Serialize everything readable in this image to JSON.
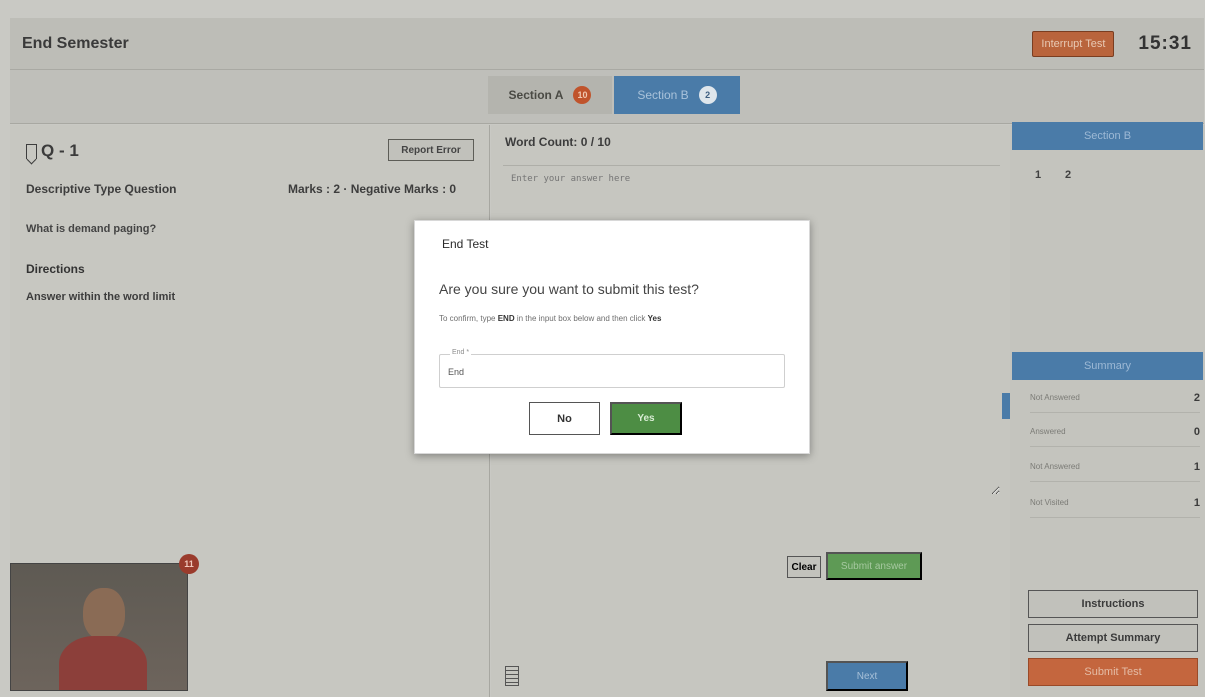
{
  "header": {
    "title": "End Semester",
    "interrupt_label": "Interrupt Test",
    "timer": "15:31"
  },
  "sections": {
    "a": {
      "label": "Section A",
      "badge": "10"
    },
    "b": {
      "label": "Section B",
      "badge": "2"
    }
  },
  "question": {
    "number": "Q - 1",
    "report_label": "Report Error",
    "type": "Descriptive Type Question",
    "marks": "Marks : 2 · Negative Marks : 0",
    "text": "What is demand paging?",
    "directions_label": "Directions",
    "directions": "Answer within the word limit"
  },
  "webcam": {
    "badge": "11"
  },
  "answer": {
    "word_count": "Word Count: 0 / 10",
    "placeholder": "Enter your answer here",
    "clear_label": "Clear",
    "save_label": "Submit answer",
    "next_label": "Next"
  },
  "right_panel": {
    "section_header": "Section B",
    "question_numbers": [
      "1",
      "2"
    ],
    "summary_header": "Summary",
    "summary": [
      {
        "label": "Not Answered",
        "value": "2"
      },
      {
        "label": "Answered",
        "value": "0"
      },
      {
        "label": "Not Answered",
        "value": "1"
      },
      {
        "label": "Not Visited",
        "value": "1"
      }
    ],
    "instructions_label": "Instructions",
    "attempt_summary_label": "Attempt Summary",
    "submit_label": "Submit Test"
  },
  "modal": {
    "title": "End Test",
    "question": "Are you sure you want to submit this test?",
    "hint_prefix": "To confirm, type",
    "hint_keyword": "END",
    "hint_middle": "in the input box below and then click",
    "hint_action": "Yes",
    "field_label": "End *",
    "field_value": "End",
    "no_label": "No",
    "yes_label": "Yes"
  },
  "colors": {
    "accent_blue": "#4a7ba8",
    "success_green": "#4d8d44",
    "danger_orange": "#c4663e"
  }
}
